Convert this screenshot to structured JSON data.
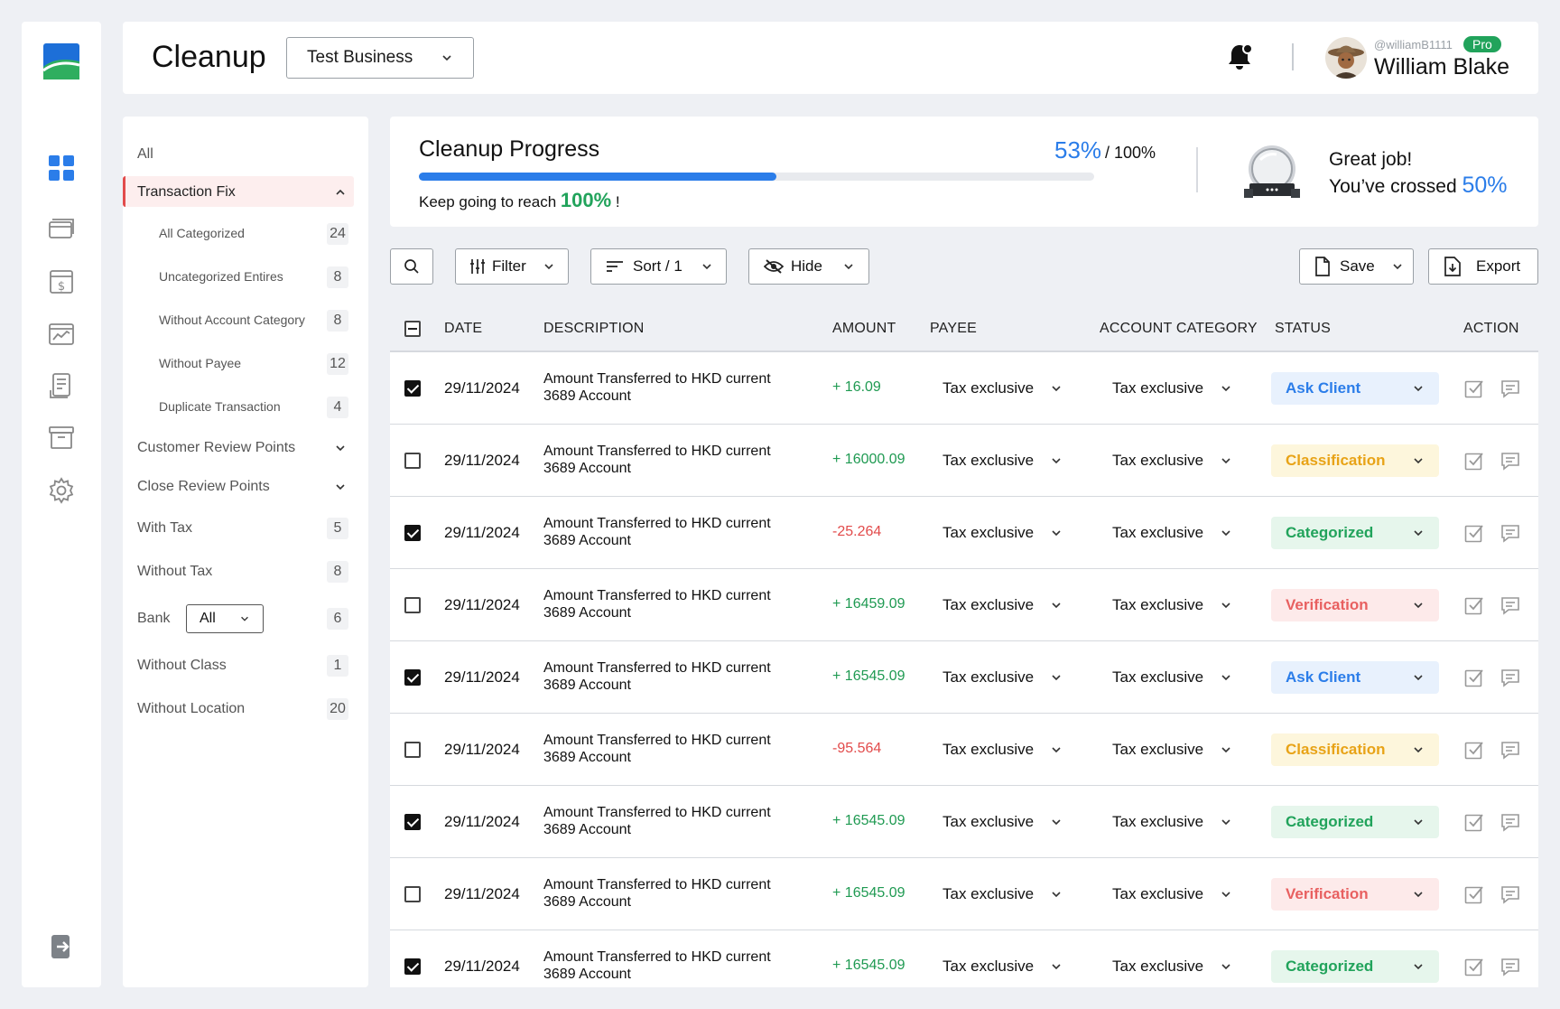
{
  "header": {
    "title": "Cleanup",
    "business": "Test Business",
    "user": {
      "handle": "@williamB1111",
      "badge": "Pro",
      "name": "William Blake"
    }
  },
  "rail": [
    "logo",
    "dashboard-icon",
    "cards-icon",
    "invoice-icon",
    "chart-icon",
    "report-icon",
    "archive-icon",
    "settings-icon",
    "logout-icon"
  ],
  "filters": {
    "all": "All",
    "transaction_fix": "Transaction Fix",
    "sub_items": [
      {
        "label": "All Categorized",
        "count": "24"
      },
      {
        "label": "Uncategorized Entires",
        "count": "8"
      },
      {
        "label": "Without Account Category",
        "count": "8"
      },
      {
        "label": "Without Payee",
        "count": "12"
      },
      {
        "label": "Duplicate Transaction",
        "count": "4"
      }
    ],
    "customer_review": "Customer Review Points",
    "close_review": "Close Review Points",
    "with_tax": {
      "label": "With Tax",
      "count": "5"
    },
    "without_tax": {
      "label": "Without Tax",
      "count": "8"
    },
    "bank": {
      "label": "Bank",
      "value": "All",
      "count": "6"
    },
    "without_class": {
      "label": "Without Class",
      "count": "1"
    },
    "without_location": {
      "label": "Without Location",
      "count": "20"
    }
  },
  "progress": {
    "title": "Cleanup Progress",
    "percent": "53%",
    "percent_value": 53,
    "total": "/ 100%",
    "hint_prefix": "Keep going to reach",
    "hint_target": "100%",
    "hint_suffix": "!",
    "great": "Great job!",
    "crossed": "You’ve crossed",
    "crossed_pct": "50%"
  },
  "toolbar": {
    "filter": "Filter",
    "sort": "Sort / 1",
    "hide": "Hide",
    "save": "Save",
    "export": "Export"
  },
  "table": {
    "columns": {
      "date": "DATE",
      "description": "DESCRIPTION",
      "amount": "AMOUNT",
      "payee": "PAYEE",
      "account_category": "ACCOUNT CATEGORY",
      "status": "STATUS",
      "action": "ACTION"
    },
    "rows": [
      {
        "checked": true,
        "date": "29/11/2024",
        "desc1": "Amount Transferred to HKD current",
        "desc2": "3689 Account",
        "amount": "+ 16.09",
        "sign": "pos",
        "payee": "Tax exclusive",
        "category": "Tax exclusive",
        "status": "Ask Client"
      },
      {
        "checked": false,
        "date": "29/11/2024",
        "desc1": "Amount Transferred to HKD current",
        "desc2": "3689 Account",
        "amount": "+ 16000.09",
        "sign": "pos",
        "payee": "Tax exclusive",
        "category": "Tax exclusive",
        "status": "Classification"
      },
      {
        "checked": true,
        "date": "29/11/2024",
        "desc1": "Amount Transferred to HKD current",
        "desc2": "3689 Account",
        "amount": "-25.264",
        "sign": "neg",
        "payee": "Tax exclusive",
        "category": "Tax exclusive",
        "status": "Categorized"
      },
      {
        "checked": false,
        "date": "29/11/2024",
        "desc1": "Amount Transferred to HKD current",
        "desc2": "3689 Account",
        "amount": "+ 16459.09",
        "sign": "pos",
        "payee": "Tax exclusive",
        "category": "Tax exclusive",
        "status": "Verification"
      },
      {
        "checked": true,
        "date": "29/11/2024",
        "desc1": "Amount Transferred to HKD current",
        "desc2": "3689 Account",
        "amount": "+ 16545.09",
        "sign": "pos",
        "payee": "Tax exclusive",
        "category": "Tax exclusive",
        "status": "Ask Client"
      },
      {
        "checked": false,
        "date": "29/11/2024",
        "desc1": "Amount Transferred to HKD current",
        "desc2": "3689 Account",
        "amount": "-95.564",
        "sign": "neg",
        "payee": "Tax exclusive",
        "category": "Tax exclusive",
        "status": "Classification"
      },
      {
        "checked": true,
        "date": "29/11/2024",
        "desc1": "Amount Transferred to HKD current",
        "desc2": "3689 Account",
        "amount": "+ 16545.09",
        "sign": "pos",
        "payee": "Tax exclusive",
        "category": "Tax exclusive",
        "status": "Categorized"
      },
      {
        "checked": false,
        "date": "29/11/2024",
        "desc1": "Amount Transferred to HKD current",
        "desc2": "3689 Account",
        "amount": "+ 16545.09",
        "sign": "pos",
        "payee": "Tax exclusive",
        "category": "Tax exclusive",
        "status": "Verification"
      },
      {
        "checked": true,
        "date": "29/11/2024",
        "desc1": "Amount Transferred to HKD current",
        "desc2": "3689 Account",
        "amount": "+ 16545.09",
        "sign": "pos",
        "payee": "Tax exclusive",
        "category": "Tax exclusive",
        "status": "Categorized"
      }
    ]
  },
  "colors": {
    "accent": "#2b7de9",
    "success": "#21a35b",
    "danger": "#e24b4b",
    "status": {
      "Ask Client": {
        "bg": "#e8f1fd",
        "fg": "#2b7de9"
      },
      "Classification": {
        "bg": "#fdf6dc",
        "fg": "#e8a317"
      },
      "Categorized": {
        "bg": "#e6f6ec",
        "fg": "#21a35b"
      },
      "Verification": {
        "bg": "#fdeaea",
        "fg": "#e86060"
      }
    }
  }
}
